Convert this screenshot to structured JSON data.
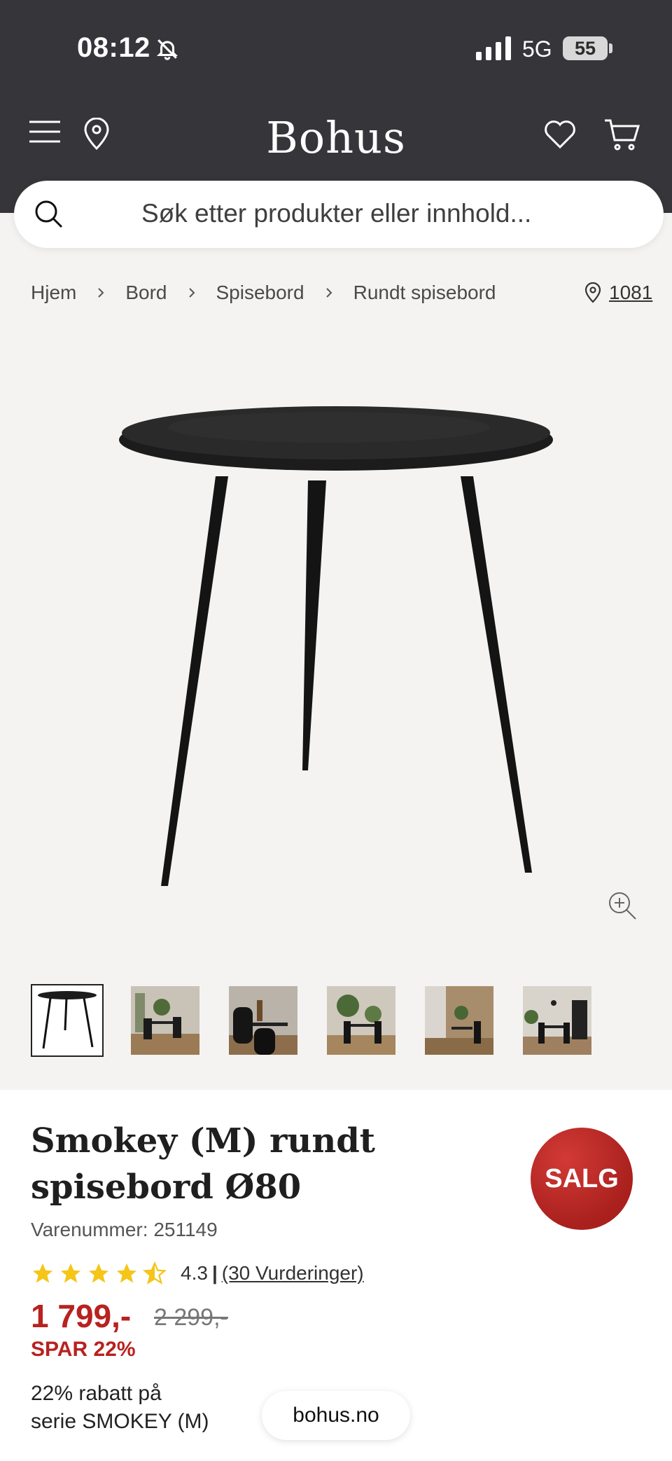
{
  "status_bar": {
    "time": "08:12",
    "network": "5G",
    "battery": "55"
  },
  "header": {
    "logo": "Bohus"
  },
  "search": {
    "placeholder": "Søk etter produkter eller innhold..."
  },
  "breadcrumb": [
    "Hjem",
    "Bord",
    "Spisebord",
    "Rundt spisebord"
  ],
  "store": {
    "label": "1081"
  },
  "product": {
    "title": "Smokey (M) rundt spisebord Ø80",
    "sku": "Varenummer: 251149",
    "rating_value": "4.3",
    "rating_sep": "|",
    "rating_count": "(30 Vurderinger)",
    "rating_fraction": 0.86,
    "price": "1 799,-",
    "old_price": "2 299,-",
    "save": "SPAR 22%",
    "sale_badge": "SALG",
    "promo_line1": "22% rabatt på",
    "promo_line2": "serie SMOKEY (M)"
  },
  "footer": {
    "url": "bohus.no"
  },
  "colors": {
    "header_bg": "#363539",
    "accent_red": "#b8221f",
    "star": "#f5c518",
    "page_bg": "#f4f3f1"
  },
  "icons": [
    "menu-icon",
    "location-pin-icon",
    "heart-icon",
    "cart-icon",
    "search-icon",
    "chevron-right-icon",
    "zoom-in-icon",
    "star-icon",
    "bell-slash-icon"
  ]
}
